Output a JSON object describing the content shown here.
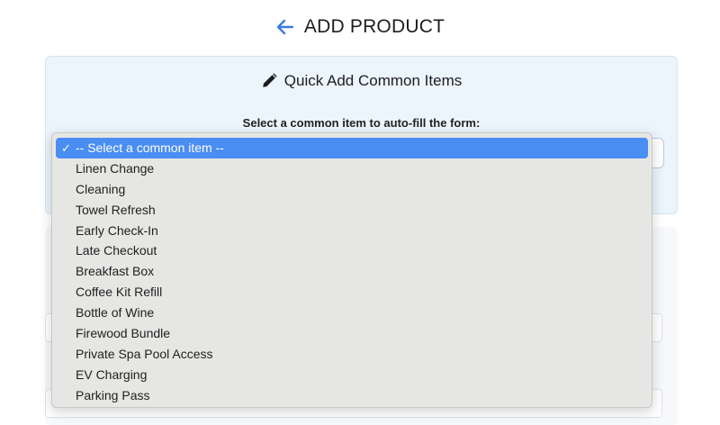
{
  "header": {
    "title": "ADD PRODUCT",
    "back_icon": "arrow-left-icon",
    "accent_color": "#3c7be0"
  },
  "quick_add": {
    "title": "Quick Add Common Items",
    "icon": "pencil-icon",
    "label": "Select a common item to auto-fill the form:",
    "background": "#ecf4fc"
  },
  "dropdown": {
    "selected_mark": "✓",
    "highlight_color": "#4a8df3",
    "options": [
      "-- Select a common item --",
      "Linen Change",
      "Cleaning",
      "Towel Refresh",
      "Early Check-In",
      "Late Checkout",
      "Breakfast Box",
      "Coffee Kit Refill",
      "Bottle of Wine",
      "Firewood Bundle",
      "Private Spa Pool Access",
      "EV Charging",
      "Parking Pass"
    ]
  }
}
